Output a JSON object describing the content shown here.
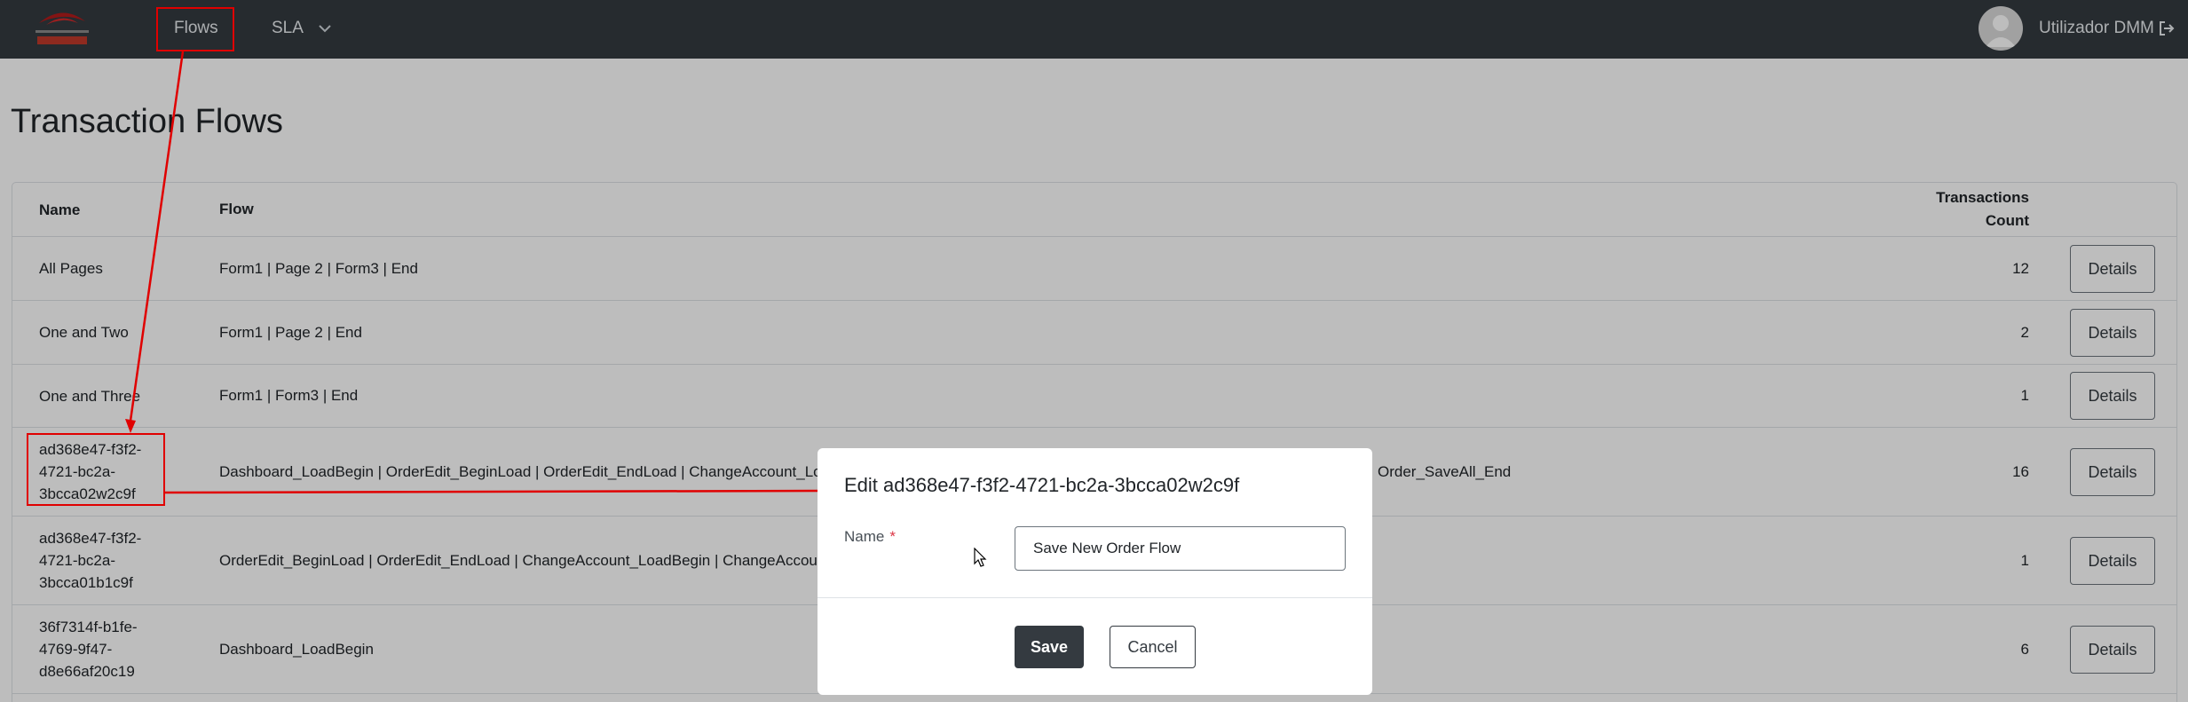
{
  "navbar": {
    "logo_icon": "company-logo-icon",
    "items": [
      {
        "label": "Flows"
      },
      {
        "label": "SLA"
      }
    ],
    "user_name": "Utilizador DMM",
    "avatar_icon": "user-avatar-icon",
    "logout_icon": "logout-icon"
  },
  "page": {
    "title": "Transaction Flows"
  },
  "table": {
    "headers": {
      "name": "Name",
      "flow": "Flow",
      "count_line1": "Transactions",
      "count_line2": "Count"
    },
    "details_label": "Details",
    "rows": [
      {
        "name": "All Pages",
        "flow": "Form1 | Page 2 | Form3 | End",
        "count": "12"
      },
      {
        "name": "One and Two",
        "flow": "Form1 | Page 2 | End",
        "count": "2"
      },
      {
        "name": "One and Three",
        "flow": "Form1 | Form3 | End",
        "count": "1"
      },
      {
        "name": "ad368e47-f3f2-4721-bc2a-3bcca02w2c9f",
        "name_lines": [
          "ad368e47-f3f2-",
          "4721-bc2a-",
          "3bcca02w2c9f"
        ],
        "flow": "Dashboard_LoadBegin | OrderEdit_BeginLoad | OrderEdit_EndLoad | ChangeAccount_Lo",
        "flow_tail": "Order_SaveAll_End",
        "count": "16"
      },
      {
        "name": "ad368e47-f3f2-4721-bc2a-3bcca01b1c9f",
        "name_lines": [
          "ad368e47-f3f2-",
          "4721-bc2a-",
          "3bcca01b1c9f"
        ],
        "flow": "OrderEdit_BeginLoad | OrderEdit_EndLoad | ChangeAccount_LoadBegin | ChangeAccoun",
        "count": "1"
      },
      {
        "name": "36f7314f-b1fe-4769-9f47-d8e66af20c19",
        "name_lines": [
          "36f7314f-b1fe-",
          "4769-9f47-",
          "d8e66af20c19"
        ],
        "flow": "Dashboard_LoadBegin",
        "count": "6"
      }
    ]
  },
  "modal": {
    "title": "Edit ad368e47-f3f2-4721-bc2a-3bcca02w2c9f",
    "name_label": "Name",
    "required_mark": "*",
    "name_value": "Save New Order Flow",
    "save_label": "Save",
    "cancel_label": "Cancel"
  },
  "colors": {
    "navbar": "#343a40",
    "annotation": "#e00000",
    "required": "#dc3545",
    "primary_button": "#343a40"
  }
}
